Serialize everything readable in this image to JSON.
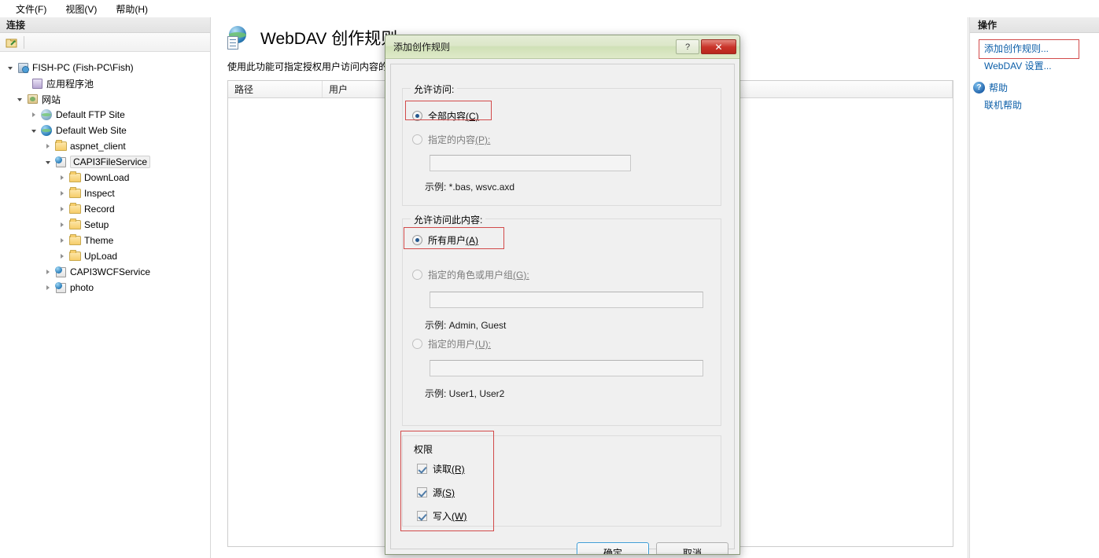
{
  "menubar": {
    "items": [
      {
        "label": "文件(F)",
        "name": "menu-file"
      },
      {
        "label": "视图(V)",
        "name": "menu-view"
      },
      {
        "label": "帮助(H)",
        "name": "menu-help"
      }
    ]
  },
  "left_panel": {
    "header": "连接",
    "toolbar": {
      "connect_icon": "connect-icon"
    },
    "tree": [
      {
        "label": "FISH-PC (Fish-PC\\Fish)",
        "icon": "server-icon",
        "expander": "open",
        "indent": 6,
        "selected": false
      },
      {
        "label": "应用程序池",
        "icon": "app-pool-icon",
        "expander": "none",
        "indent": 24,
        "selected": false
      },
      {
        "label": "网站",
        "icon": "sites-icon",
        "expander": "open",
        "indent": 18,
        "selected": false
      },
      {
        "label": "Default FTP Site",
        "icon": "globe-gray-icon",
        "expander": "closed",
        "indent": 36,
        "selected": false
      },
      {
        "label": "Default Web Site",
        "icon": "globe-icon",
        "expander": "open",
        "indent": 36,
        "selected": false
      },
      {
        "label": "aspnet_client",
        "icon": "folder-icon",
        "expander": "closed",
        "indent": 54,
        "selected": false
      },
      {
        "label": "CAPI3FileService",
        "icon": "vdir-icon",
        "expander": "open",
        "indent": 54,
        "selected": true
      },
      {
        "label": "DownLoad",
        "icon": "folder-icon",
        "expander": "closed",
        "indent": 72,
        "selected": false
      },
      {
        "label": "Inspect",
        "icon": "folder-icon",
        "expander": "closed",
        "indent": 72,
        "selected": false
      },
      {
        "label": "Record",
        "icon": "folder-icon",
        "expander": "closed",
        "indent": 72,
        "selected": false
      },
      {
        "label": "Setup",
        "icon": "folder-icon",
        "expander": "closed",
        "indent": 72,
        "selected": false
      },
      {
        "label": "Theme",
        "icon": "folder-icon",
        "expander": "closed",
        "indent": 72,
        "selected": false
      },
      {
        "label": "UpLoad",
        "icon": "folder-icon",
        "expander": "closed",
        "indent": 72,
        "selected": false
      },
      {
        "label": "CAPI3WCFService",
        "icon": "vdir-icon",
        "expander": "closed",
        "indent": 54,
        "selected": false
      },
      {
        "label": "photo",
        "icon": "vdir-icon",
        "expander": "closed",
        "indent": 54,
        "selected": false
      }
    ]
  },
  "main": {
    "title": "WebDAV 创作规则",
    "description": "使用此功能可指定授权用户访问内容的",
    "grid": {
      "columns": [
        "路径",
        "用户"
      ],
      "rows": []
    }
  },
  "right_panel": {
    "header": "操作",
    "links": [
      {
        "label": "添加创作规则...",
        "name": "action-add-authoring-rule",
        "icon": "none",
        "highlighted": true
      },
      {
        "label": "WebDAV 设置...",
        "name": "action-webdav-settings",
        "icon": "none",
        "highlighted": false
      },
      {
        "label": "帮助",
        "name": "action-help",
        "icon": "help-icon",
        "highlighted": false
      },
      {
        "label": "联机帮助",
        "name": "action-online-help",
        "icon": "none",
        "highlighted": false
      }
    ],
    "help_glyph": "?"
  },
  "dialog": {
    "title": "添加创作规则",
    "titlebar_buttons": {
      "help": "?",
      "close": "✕"
    },
    "allow_access_group": {
      "title": "允许访问:",
      "options": [
        {
          "label_main": "全部内容",
          "label_key": "(C)",
          "mnemonic": "C",
          "checked": true,
          "highlighted": true
        },
        {
          "label_main": "指定的内容",
          "label_key": "(P):",
          "mnemonic": "P",
          "checked": false,
          "highlighted": false
        }
      ],
      "input_value": "",
      "input_placeholder": "",
      "hint": "示例: *.bas, wsvc.axd"
    },
    "allow_users_group": {
      "title": "允许访问此内容:",
      "options": [
        {
          "label_main": "所有用户",
          "label_key": "(A)",
          "mnemonic": "A",
          "checked": true,
          "highlighted": true
        },
        {
          "label_main": "指定的角色或用户组",
          "label_key": "(G):",
          "mnemonic": "G",
          "checked": false,
          "highlighted": false
        },
        {
          "label_main": "指定的用户",
          "label_key": "(U):",
          "mnemonic": "U",
          "checked": false,
          "highlighted": false
        }
      ],
      "roles_input_value": "",
      "roles_hint": "示例: Admin, Guest",
      "users_input_value": "",
      "users_hint": "示例: User1, User2"
    },
    "permissions_group": {
      "title": "权限",
      "highlighted": true,
      "items": [
        {
          "label_main": "读取",
          "label_key": "(R)",
          "mnemonic": "R",
          "checked": true
        },
        {
          "label_main": "源",
          "label_key": "(S)",
          "mnemonic": "S",
          "checked": true
        },
        {
          "label_main": "写入",
          "label_key": "(W)",
          "mnemonic": "W",
          "checked": true
        }
      ]
    },
    "buttons": {
      "ok": "确定",
      "cancel": "取消"
    }
  },
  "colors": {
    "highlight_red": "#d24a4a",
    "link_blue": "#0b5ea8",
    "dialog_title_green": "#dce7c9",
    "close_red": "#c9342a",
    "default_button_border": "#3c9bd4"
  }
}
